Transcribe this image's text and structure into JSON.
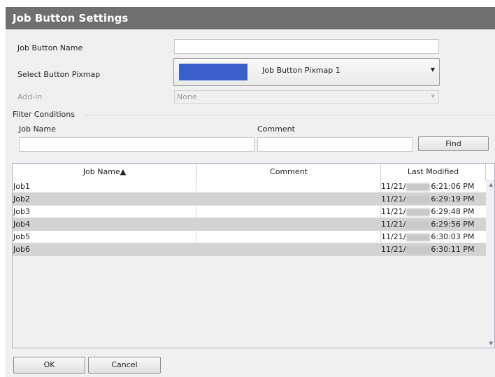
{
  "window": {
    "title": "Job Button Settings"
  },
  "form": {
    "job_button_name_label": "Job Button Name",
    "job_button_name_value": "",
    "select_pixmap_label": "Select Button Pixmap",
    "pixmap_selected": "Job Button Pixmap 1",
    "pixmap_swatch_color": "#3a5fcd",
    "addin_label": "Add-in",
    "addin_value": "None"
  },
  "filter": {
    "group_label": "Filter Conditions",
    "job_name_label": "Job Name",
    "job_name_value": "",
    "comment_label": "Comment",
    "comment_value": "",
    "find_label": "Find"
  },
  "table": {
    "headers": [
      "Job Name▲",
      "Comment",
      "Last Modified"
    ],
    "rows": [
      {
        "name": "Job1",
        "comment": "",
        "date": "11/21/",
        "time": "6:21:06 PM"
      },
      {
        "name": "Job2",
        "comment": "",
        "date": "11/21/",
        "time": "6:29:19 PM"
      },
      {
        "name": "Job3",
        "comment": "",
        "date": "11/21/",
        "time": "6:29:48 PM"
      },
      {
        "name": "Job4",
        "comment": "",
        "date": "11/21/",
        "time": "6:29:56 PM"
      },
      {
        "name": "Job5",
        "comment": "",
        "date": "11/21/",
        "time": "6:30:03 PM"
      },
      {
        "name": "Job6",
        "comment": "",
        "date": "11/21/",
        "time": "6:30:11 PM"
      }
    ]
  },
  "footer": {
    "ok_label": "OK",
    "cancel_label": "Cancel"
  }
}
